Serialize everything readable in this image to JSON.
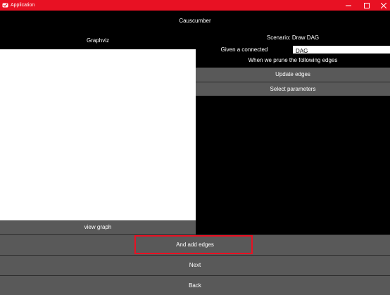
{
  "window": {
    "title": "Application",
    "minimize_icon": "minimize-icon",
    "maximize_icon": "maximize-icon",
    "close_icon": "close-icon"
  },
  "header": {
    "app_name": "Causcumber"
  },
  "left_panel": {
    "title": "Graphviz",
    "view_graph_label": "view graph"
  },
  "right_panel": {
    "scenario_label": "Scenario: Draw DAG",
    "given_label": "Given a connected",
    "given_input_value": "DAG",
    "prune_label": "When we prune the following edges",
    "update_edges_label": "Update edges",
    "select_parameters_label": "Select parameters"
  },
  "footer": {
    "add_edges_label": "And add edges",
    "next_label": "Next",
    "back_label": "Back"
  },
  "colors": {
    "titlebar": "#e81123",
    "button": "#595959",
    "background": "#000000",
    "highlight": "#e81123"
  }
}
